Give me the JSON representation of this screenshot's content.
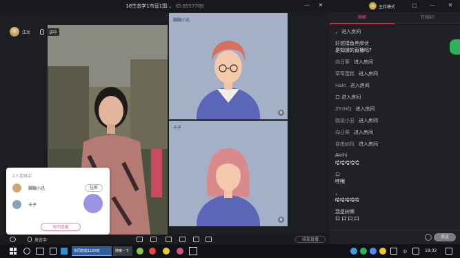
{
  "window": {
    "title": "18生态学1市营1国...",
    "room_id": "ID:8557788",
    "minimize": "—",
    "close": "✕"
  },
  "host": {
    "name": "江兰",
    "mic_tag": "讲中"
  },
  "tiles": [
    {
      "name": "蹦蹦小迅"
    },
    {
      "name": "卡子"
    }
  ],
  "popup": {
    "title": "2人连线中",
    "rows": [
      {
        "name": "蹦蹦小迅",
        "action": "挂断"
      },
      {
        "name": "卡子",
        "action": ""
      }
    ],
    "close_link": "关闭连麦"
  },
  "toolbar": {
    "mic_label": "发言中",
    "end_label": "结束直播"
  },
  "panel": {
    "mode_label": "主持模式",
    "tabs": [
      {
        "label": "群聊"
      },
      {
        "label": "在线87"
      }
    ],
    "messages": [
      {
        "nick": "",
        "text": "， 进入房间",
        "strong": false
      },
      {
        "nick": "",
        "text": "好想摸鱼黑摩伏",
        "strong": false
      },
      {
        "nick": "",
        "text": "是知道的直播吗?",
        "strong": true
      },
      {
        "nick": "向日葵",
        "text": "进入房间",
        "strong": false
      },
      {
        "nick": "草莓蛋糕",
        "text": "进入房间",
        "strong": false
      },
      {
        "nick": "Halo",
        "text": "进入房间",
        "strong": false
      },
      {
        "nick": "",
        "text": "  口 进入房间",
        "strong": false
      },
      {
        "nick": "ZYzHQ",
        "text": "进入房间",
        "strong": false
      },
      {
        "nick": "跳梁小丑",
        "text": "进入房间",
        "strong": false
      },
      {
        "nick": "向日葵",
        "text": "进入房间",
        "strong": false
      },
      {
        "nick": "自由如风",
        "text": "进入房间",
        "strong": false
      },
      {
        "nick": "",
        "text": "Akihi",
        "strong": false
      },
      {
        "nick": "",
        "text": "哈哈哈哈哈",
        "strong": true
      },
      {
        "nick": "",
        "text": "  口",
        "strong": false
      },
      {
        "nick": "",
        "text": "哇哦",
        "strong": true
      },
      {
        "nick": "",
        "text": "，",
        "strong": false
      },
      {
        "nick": "",
        "text": "哈哈哈哈哈",
        "strong": true
      },
      {
        "nick": "",
        "text": "我是树懒",
        "strong": false
      },
      {
        "nick": "",
        "text": "  口    口    口    口",
        "strong": true
      }
    ],
    "send_label": "发送"
  },
  "taskbar": {
    "active_app": "协同智能1100班",
    "search_tab": "搜索一下",
    "ime": "中",
    "clock": "18:32"
  }
}
